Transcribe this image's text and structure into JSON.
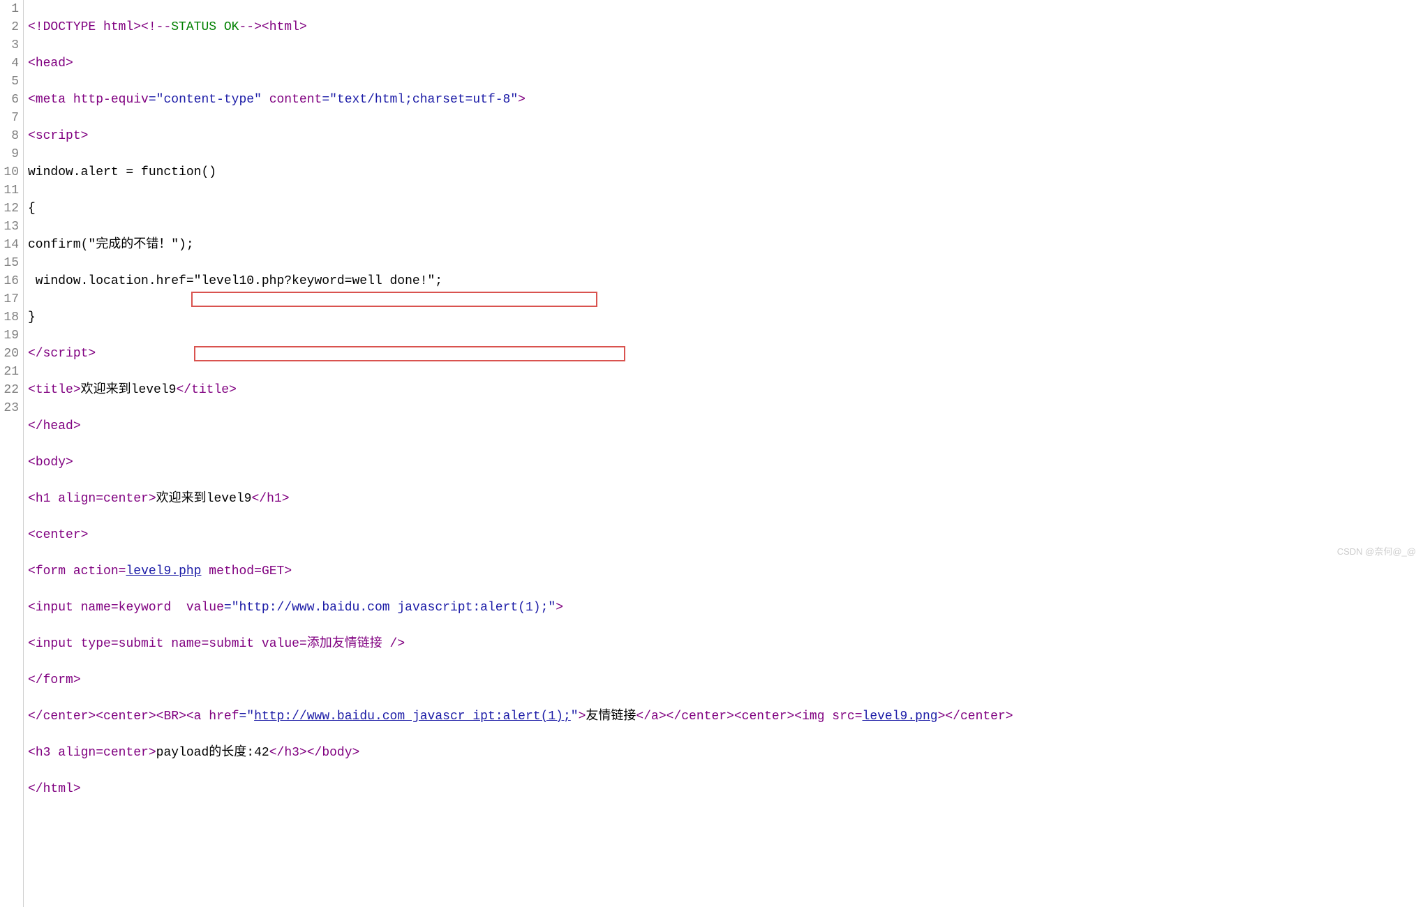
{
  "gutter": [
    "1",
    "2",
    "3",
    "4",
    "5",
    "6",
    "7",
    "8",
    "9",
    "10",
    "11",
    "12",
    "13",
    "14",
    "15",
    "16",
    "17",
    "18",
    "19",
    "20",
    "21",
    "22",
    "23"
  ],
  "lines": {
    "l1": {
      "a": "<!",
      "b": "DOCTYPE html",
      "c": "><!--",
      "d": "STATUS OK",
      "e": "--><",
      "f": "html",
      "g": ">"
    },
    "l2": {
      "a": "<",
      "b": "head",
      "c": ">"
    },
    "l3": {
      "a": "<",
      "b": "meta",
      "c": " http-equiv",
      "d": "=\"content-type\"",
      "e": " content",
      "f": "=\"text/html;charset=utf-8\"",
      "g": ">"
    },
    "l4": {
      "a": "<",
      "b": "script",
      "c": ">"
    },
    "l5": {
      "a": "window.alert = function()"
    },
    "l6": {
      "a": "{"
    },
    "l7": {
      "a": "confirm(\"完成的不错！\");"
    },
    "l8": {
      "a": " window.location.href=\"level10.php?keyword=well done!\";"
    },
    "l9": {
      "a": "}"
    },
    "l10": {
      "a": "</",
      "b": "script",
      "c": ">"
    },
    "l11": {
      "a": "<",
      "b": "title",
      "c": ">",
      "d": "欢迎来到level9",
      "e": "</",
      "f": "title",
      "g": ">"
    },
    "l12": {
      "a": "</",
      "b": "head",
      "c": ">"
    },
    "l13": {
      "a": "<",
      "b": "body",
      "c": ">"
    },
    "l14": {
      "a": "<",
      "b": "h1",
      "c": " align",
      "d": "=",
      "e": "center",
      "f": ">",
      "g": "欢迎来到level9",
      "h": "</",
      "i": "h1",
      "j": ">"
    },
    "l15": {
      "a": "<",
      "b": "center",
      "c": ">"
    },
    "l16": {
      "a": "<",
      "b": "form",
      "c": " action",
      "d": "=",
      "e": "level9.php",
      "f": " method",
      "g": "=",
      "h": "GET",
      "i": ">"
    },
    "l17": {
      "a": "<",
      "b": "input",
      "c": " name",
      "d": "=",
      "e": "keyword",
      "f": "  value",
      "g": "=\"http://www.baidu.com javascript:alert(1);\"",
      "h": ">"
    },
    "l18": {
      "a": "<",
      "b": "input",
      "c": " type",
      "d": "=",
      "e": "submit",
      "f": " name",
      "g": "=",
      "h": "submit",
      "i": " value",
      "j": "=",
      "k": "添加友情链接",
      "l": " />"
    },
    "l19": {
      "a": "</",
      "b": "form",
      "c": ">"
    },
    "l20": {
      "a": "</",
      "b": "center",
      "c": "><",
      "d": "center",
      "e": "><",
      "f": "BR",
      "g": "><",
      "h": "a",
      "i": " href",
      "j": "=\"",
      "k": "http://www.baidu.com javascr_ipt:alert(1);",
      "l": "\"",
      "m": ">",
      "n": "友情链接",
      "o": "</",
      "p": "a",
      "q": "></",
      "r": "center",
      "s": "><",
      "t": "center",
      "u": "><",
      "v": "img",
      "w": " src",
      "x": "=",
      "y": "level9.png",
      "z": "></",
      "aa": "center",
      "ab": ">"
    },
    "l21": {
      "a": "<",
      "b": "h3",
      "c": " align",
      "d": "=",
      "e": "center",
      "f": ">",
      "g": "payload的长度:42",
      "h": "</",
      "i": "h3",
      "j": "></",
      "k": "body",
      "l": ">"
    },
    "l22": {
      "a": "</",
      "b": "html",
      "c": ">"
    }
  },
  "watermark": "CSDN @奈何@_@"
}
